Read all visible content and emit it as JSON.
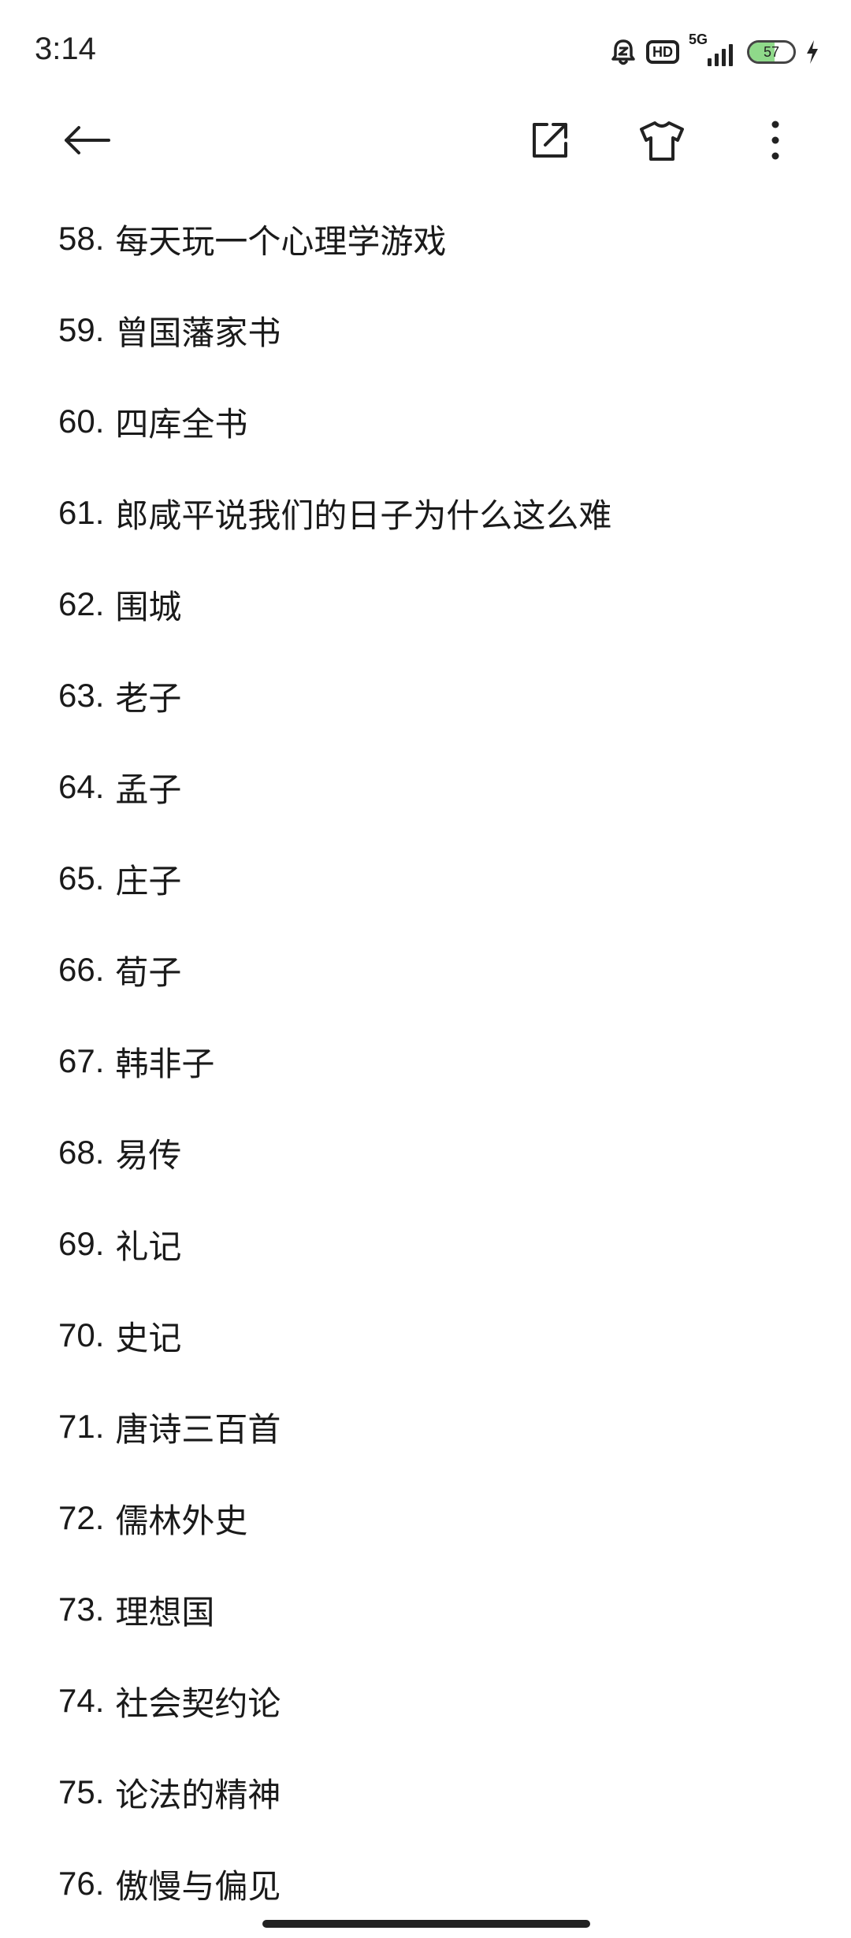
{
  "status_bar": {
    "time": "3:14",
    "network": "5G",
    "hd_label": "HD",
    "battery_percent": "57",
    "battery_level": 0.57,
    "icons": [
      "alarm-icon",
      "hd-icon",
      "signal-5g-icon",
      "battery-icon",
      "charging-bolt-icon"
    ]
  },
  "toolbar": {
    "icons": [
      "back-arrow-icon",
      "share-external-icon",
      "tshirt-theme-icon",
      "more-vertical-icon"
    ]
  },
  "list": {
    "items": [
      {
        "num": "58.",
        "text": "每天玩一个心理学游戏"
      },
      {
        "num": "59.",
        "text": "曾国藩家书"
      },
      {
        "num": "60.",
        "text": "四库全书"
      },
      {
        "num": "61.",
        "text": "郎咸平说我们的日子为什么这么难"
      },
      {
        "num": "62.",
        "text": "围城"
      },
      {
        "num": "63.",
        "text": "老子"
      },
      {
        "num": "64.",
        "text": "孟子"
      },
      {
        "num": "65.",
        "text": "庄子"
      },
      {
        "num": "66.",
        "text": "荀子"
      },
      {
        "num": "67.",
        "text": "韩非子"
      },
      {
        "num": "68.",
        "text": "易传"
      },
      {
        "num": "69.",
        "text": "礼记"
      },
      {
        "num": "70.",
        "text": "史记"
      },
      {
        "num": "71.",
        "text": "唐诗三百首"
      },
      {
        "num": "72.",
        "text": "儒林外史"
      },
      {
        "num": "73.",
        "text": "理想国"
      },
      {
        "num": "74.",
        "text": "社会契约论"
      },
      {
        "num": "75.",
        "text": "论法的精神"
      },
      {
        "num": "76.",
        "text": "傲慢与偏见"
      }
    ]
  },
  "colors": {
    "text": "#1a1a1a",
    "battery_fill": "#8fd98a",
    "background": "#ffffff"
  }
}
